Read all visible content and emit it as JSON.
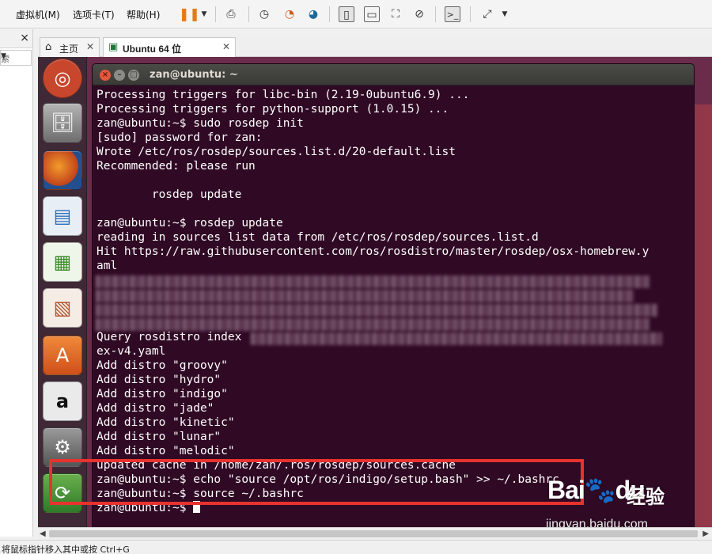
{
  "menubar": {
    "items": [
      "虚拟机(M)",
      "选项卡(T)",
      "帮助(H)"
    ]
  },
  "toolbar": {
    "icons": [
      "pause-icon",
      "dropdown-icon",
      "send-keys-icon",
      "snapshot-icon",
      "revert-snapshot-icon",
      "snapshot-manager-icon",
      "library-view-icon",
      "thumbnail-view-icon",
      "fullscreen-icon",
      "unity-icon",
      "console-icon",
      "fit-guest-icon",
      "dropdown-icon"
    ]
  },
  "library": {
    "close": "×",
    "search_placeholder": "索"
  },
  "tabs": [
    {
      "label": "主页",
      "icon": "home-icon",
      "active": false
    },
    {
      "label": "Ubuntu 64 位",
      "icon": "vm-icon",
      "active": true
    }
  ],
  "launcher": [
    {
      "name": "ubuntu-dash-icon",
      "color": "#c8472c"
    },
    {
      "name": "files-icon",
      "color": "#8a8a8a"
    },
    {
      "name": "firefox-icon",
      "color": "#3a6fb0"
    },
    {
      "name": "writer-icon",
      "color": "#2f6db5"
    },
    {
      "name": "calc-icon",
      "color": "#4c9a2a"
    },
    {
      "name": "impress-icon",
      "color": "#b0522f"
    },
    {
      "name": "software-center-icon",
      "color": "#e2662a"
    },
    {
      "name": "amazon-icon",
      "color": "#e9e9e9"
    },
    {
      "name": "settings-icon",
      "color": "#7b7b7b"
    },
    {
      "name": "update-icon",
      "color": "#4f8f3a"
    }
  ],
  "terminal": {
    "title": "zan@ubuntu: ~",
    "lines": [
      "Processing triggers for libc-bin (2.19-0ubuntu6.9) ...",
      "Processing triggers for python-support (1.0.15) ...",
      "zan@ubuntu:~$ sudo rosdep init",
      "[sudo] password for zan:",
      "Wrote /etc/ros/rosdep/sources.list.d/20-default.list",
      "Recommended: please run",
      "",
      "        rosdep update",
      "",
      "zan@ubuntu:~$ rosdep update",
      "reading in sources list data from /etc/ros/rosdep/sources.list.d",
      "Hit https://raw.githubusercontent.com/ros/rosdistro/master/rosdep/osx-homebrew.y",
      "aml",
      "",
      "",
      "",
      "",
      "Query rosdistro index",
      "ex-v4.yaml",
      "Add distro \"groovy\"",
      "Add distro \"hydro\"",
      "Add distro \"indigo\"",
      "Add distro \"jade\"",
      "Add distro \"kinetic\"",
      "Add distro \"lunar\"",
      "Add distro \"melodic\"",
      "updated cache in /home/zan/.ros/rosdep/sources.cache",
      "zan@ubuntu:~$ echo \"source /opt/ros/indigo/setup.bash\" >> ~/.bashrc",
      "zan@ubuntu:~$ source ~/.bashrc",
      "zan@ubuntu:~$ "
    ]
  },
  "watermark": {
    "logo": "Bai",
    "logo_paw": "du",
    "cn": "经验",
    "url": "jingyan.baidu.com"
  },
  "status": {
    "text": "将鼠标指针移入其中或按 Ctrl+G"
  },
  "colors": {
    "terminal_bg": "#300a24",
    "highlight": "#e8322e",
    "launcher_bg": "#3f2936"
  }
}
